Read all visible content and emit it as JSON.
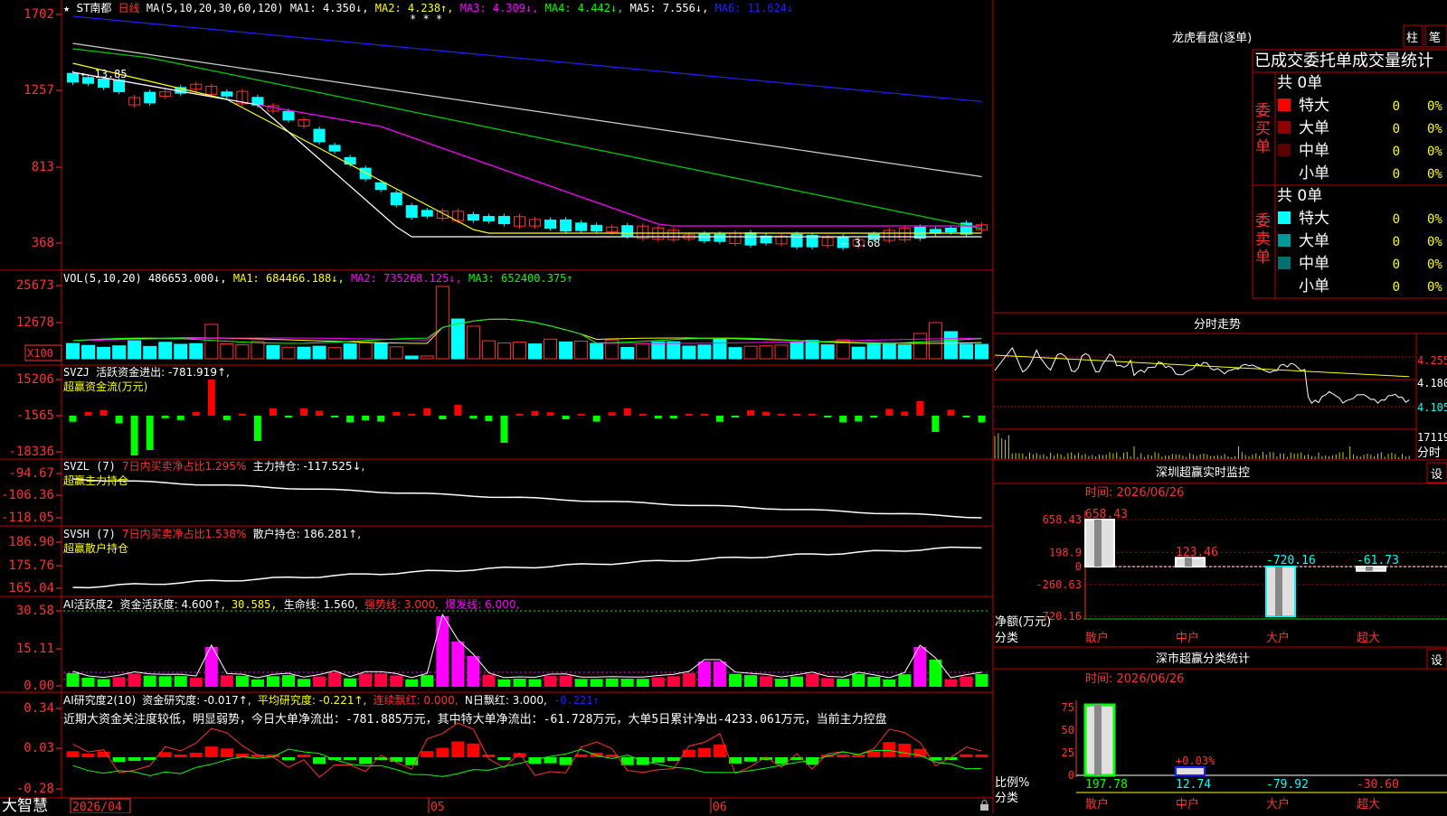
{
  "colors": {
    "up": "#ff3030",
    "down": "#00ffff",
    "green": "#00ff00",
    "grid": "#b00000",
    "axis": "#ff4040",
    "yellow": "#ffff00",
    "magenta": "#ff00ff",
    "blue": "#2020ff",
    "white": "#ffffff"
  },
  "icons": {
    "star": "star-icon",
    "lock": "lock-icon"
  },
  "price_panel": {
    "star": "★",
    "stock": "ST南都",
    "period": "日线",
    "ma_label": "MA(5,10,20,30,60,120)",
    "ma1": "MA1: 4.350↓,",
    "ma2": "MA2: 4.238↑,",
    "ma3": "MA3: 4.309↓,",
    "ma4": "MA4: 4.442↓,",
    "ma5": "MA5: 7.556↓,",
    "ma6": "MA6: 11.624↓",
    "yticks": [
      "1702",
      "1257",
      "813",
      "368"
    ],
    "high_label": "13.85",
    "low_label": "3.68",
    "marks": "* * *"
  },
  "vol_panel": {
    "title": "VOL(5,10,20)",
    "value": "486653.000↓,",
    "ma1": "MA1: 684466.188↓,",
    "ma2": "MA2: 735268.125↓,",
    "ma3": "MA3: 652400.375↑",
    "yticks": [
      "25673",
      "12678"
    ],
    "unit": "X100"
  },
  "svzj_panel": {
    "title": "SVZJ",
    "line1": "活跃资金进出: -781.919↑,",
    "line2": "超赢资金流(万元)",
    "yticks": [
      "15206",
      "-1565",
      "-18336"
    ]
  },
  "svzl_panel": {
    "title": "SVZL (7)",
    "net": "7日内买卖净占比1.295%",
    "hold": "主力持仓: -117.525↓,",
    "line2": "超赢主力持仓",
    "yticks": [
      "-94.67",
      "-106.36",
      "-118.05"
    ]
  },
  "svsh_panel": {
    "title": "SVSH (7)",
    "net": "7日内买卖净占比1.538%",
    "hold": "散户持仓: 186.281↑,",
    "line2": "超赢散户持仓",
    "yticks": [
      "186.90",
      "175.76",
      "165.04"
    ]
  },
  "ai2_panel": {
    "title": "AI活跃度2",
    "a": "资金活跃度: 4.600↑,",
    "b": "30.585,",
    "c": "生命线: 1.560,",
    "d": "强势线: 3.000,",
    "e": "爆发线: 6.000,",
    "yticks": [
      "30.58",
      "15.11",
      "0.00"
    ]
  },
  "ai_research_panel": {
    "title": "AI研究度2(10)",
    "a": "资金研究度: -0.017↑,",
    "b": "平均研究度: -0.221↑,",
    "c": "连续飘红: 0.000,",
    "d": "N日飘红: 3.000,",
    "e": "-0.221↑",
    "comment": "近期大资金关注度较低，明显弱势，今日大单净流出：-781.885万元，其中特大单净流出：-61.728万元，大单5日累计净出-4233.061万元，当前主力控盘",
    "yticks": [
      "0.34",
      "0.03",
      "-0.28"
    ]
  },
  "bottom_bar": {
    "brand": "大智慧",
    "dates": [
      "2026/04",
      "05",
      "06"
    ]
  },
  "dragon_panel": {
    "title": "龙虎看盘(逐单)",
    "btn1": "柱",
    "btn2": "笔",
    "subtitle": "已成交委托单成交量统计",
    "buy_label": "委买单",
    "sell_label": "委卖单",
    "buy_total": "共 0单",
    "sell_total": "共 0单",
    "buy_rows": [
      {
        "color": "#ff0000",
        "label": "特大",
        "value": "0",
        "pct": "0%"
      },
      {
        "color": "#900000",
        "label": "大单",
        "value": "0",
        "pct": "0%"
      },
      {
        "color": "#5a0000",
        "label": "中单",
        "value": "0",
        "pct": "0%"
      },
      {
        "color": "#000000",
        "label": "小单",
        "value": "0",
        "pct": "0%"
      }
    ],
    "sell_rows": [
      {
        "color": "#00ffff",
        "label": "特大",
        "value": "0",
        "pct": "0%"
      },
      {
        "color": "#009999",
        "label": "大单",
        "value": "0",
        "pct": "0%"
      },
      {
        "color": "#007070",
        "label": "中单",
        "value": "0",
        "pct": "0%"
      },
      {
        "color": "#000000",
        "label": "小单",
        "value": "0",
        "pct": "0%"
      }
    ]
  },
  "intraday_panel": {
    "title": "分时走势",
    "yticks": [
      "4.255",
      "4.180",
      "4.105"
    ],
    "vol_label": "17119",
    "vol_unit": "分时"
  },
  "monitor_panel": {
    "title": "深圳超赢实时监控",
    "gear": "设",
    "time": "时间: 2026/06/26",
    "yticks": [
      "658.43",
      "198.9",
      "0",
      "-260.63",
      "-720.16"
    ],
    "ylabel": "净额(万元)",
    "xlabel": "分类",
    "bars": [
      {
        "cat": "散户",
        "value": 658.43,
        "label": "658.43"
      },
      {
        "cat": "中户",
        "value": 123.46,
        "label": "123.46"
      },
      {
        "cat": "大户",
        "value": -720.16,
        "label": "-720.16"
      },
      {
        "cat": "超大",
        "value": -61.73,
        "label": "-61.73"
      }
    ]
  },
  "stats_panel": {
    "title": "深市超赢分类统计",
    "gear": "设",
    "time": "时间: 2026/06/26",
    "yticks": [
      "75",
      "50",
      "25",
      "0"
    ],
    "ylabel": "比例%",
    "xlabel": "分类",
    "bars": [
      {
        "cat": "散户",
        "value": 197.78,
        "label": "197.78"
      },
      {
        "cat": "中户",
        "value": 12.74,
        "label": "12.74",
        "pct": "+0.03%"
      },
      {
        "cat": "大户",
        "value": -79.92,
        "label": "-79.92"
      },
      {
        "cat": "超大",
        "value": -30.6,
        "label": "-30.60"
      }
    ]
  }
}
